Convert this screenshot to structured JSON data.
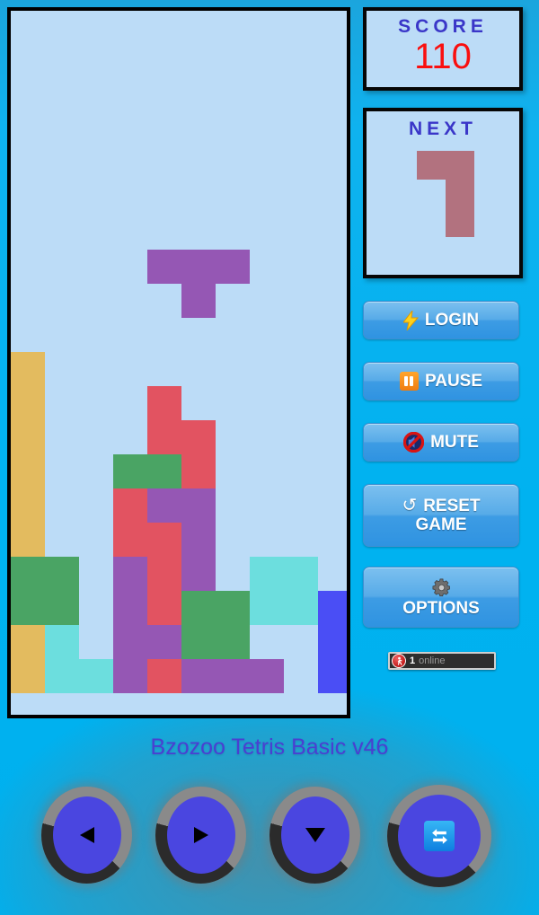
{
  "app": {
    "title": "Bzozoo Tetris Basic v46",
    "title_color": "#4a3fd2",
    "background_color": "#00b2f0"
  },
  "score_panel": {
    "label": "SCORE",
    "value": "110",
    "label_color": "#3a36c8",
    "value_color": "#fa0f0f"
  },
  "next_panel": {
    "label": "NEXT",
    "piece": "J",
    "piece_color": "#b2727f",
    "cells": [
      [
        0,
        0
      ],
      [
        1,
        0
      ],
      [
        1,
        1
      ],
      [
        1,
        2
      ]
    ]
  },
  "buttons": {
    "login": {
      "label": "LOGIN",
      "icon": "lightning-bolt-icon"
    },
    "pause": {
      "label": "PAUSE",
      "icon": "pause-icon"
    },
    "mute": {
      "label": "MUTE",
      "icon": "mute-speaker-icon"
    },
    "reset": {
      "label_line1": "RESET",
      "label_line2": "GAME",
      "icon": "refresh-icon",
      "icon_glyph": "↺"
    },
    "options": {
      "label": "OPTIONS",
      "icon": "gear-icon"
    }
  },
  "online_badge": {
    "count": "1",
    "text": "online",
    "icon": "runner-icon"
  },
  "controls": [
    {
      "name": "move-left",
      "glyph": "left-triangle-icon"
    },
    {
      "name": "move-right",
      "glyph": "right-triangle-icon"
    },
    {
      "name": "move-down",
      "glyph": "down-triangle-icon"
    },
    {
      "name": "rotate",
      "glyph": "rotate-arrows-icon"
    }
  ],
  "board": {
    "cols": 10,
    "rows": 20,
    "cell": 38,
    "empty_color": "#bcdcf7",
    "border_color": "#060606",
    "palette": {
      "R": "#e25361",
      "G": "#4aa464",
      "Y": "#e3bb5f",
      "P": "#9557b4",
      "C": "#6cdede",
      "B": "#4a4ef5",
      "_": "#bcdcf7"
    },
    "active_piece": {
      "type": "T",
      "color": "#9557b4",
      "cells": [
        [
          4,
          7
        ],
        [
          5,
          7
        ],
        [
          6,
          7
        ],
        [
          5,
          8
        ]
      ]
    },
    "grid": [
      "__________",
      "__________",
      "__________",
      "__________",
      "__________",
      "__________",
      "__________",
      "__________",
      "__________",
      "Y_________",
      "Y___R_____",
      "Y___RR____",
      "Y__GGR____",
      "Y__RPP____",
      "Y__RRP____",
      "GG_PRP_CC_",
      "GG_PRGGCCB",
      "YC_PPGG__B",
      "YCCPRPPP_B"
    ]
  }
}
